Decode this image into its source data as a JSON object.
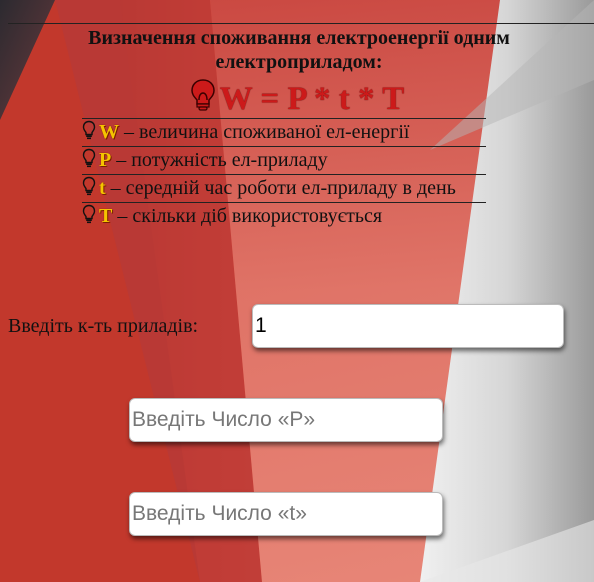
{
  "heading": {
    "line": "Визначення споживання електроенергії одним електроприладом:"
  },
  "formula": {
    "text": "W = P * t * T"
  },
  "definitions": [
    {
      "symbol": "W",
      "text": " – величина споживаної ел-енергії"
    },
    {
      "symbol": "P",
      "text": " – потужність ел-приладу"
    },
    {
      "symbol": "t",
      "text": " – середній час роботи ел-приладу в день"
    },
    {
      "symbol": "T",
      "text": " – скільки діб використовується"
    }
  ],
  "form": {
    "count_label": "Введіть к-ть приладів:",
    "count_value": "1",
    "p_placeholder": "Введіть Число «P»",
    "t_placeholder": "Введіть Число «t»"
  },
  "colors": {
    "formula": "#cc1a1a",
    "symbol": "#f5c400",
    "background_red": "#d9392c",
    "background_gray": "#c8c8c8"
  },
  "icons": {
    "bulb": "light-bulb-icon"
  }
}
